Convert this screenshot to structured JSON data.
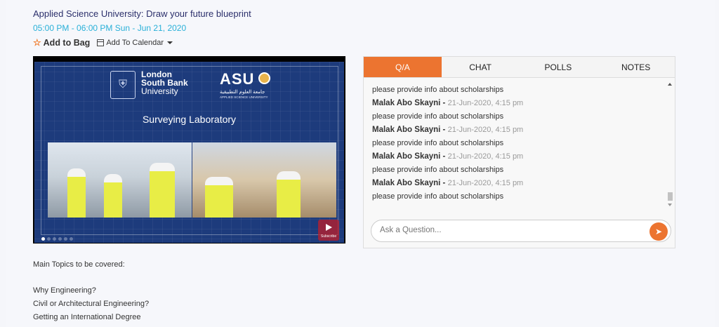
{
  "event": {
    "title": "Applied Science University: Draw your future blueprint",
    "time": "05:00 PM - 06:00 PM  Sun - Jun 21, 2020",
    "add_to_bag": "Add to Bag",
    "add_to_calendar": "Add To Calendar"
  },
  "video": {
    "lsbu_line1": "London",
    "lsbu_line2": "South Bank",
    "lsbu_line3": "University",
    "asu": "ASU",
    "asu_arabic": "جامعة العلوم التطبيقية",
    "asu_english": "APPLIED SCIENCE UNIVERSITY",
    "caption": "Surveying Laboratory",
    "subscribe": "Subscribe"
  },
  "panel": {
    "tabs": [
      "Q/A",
      "CHAT",
      "POLLS",
      "NOTES"
    ],
    "active_tab": "Q/A",
    "messages": [
      {
        "text": "please provide info about scholarships"
      },
      {
        "author": "Malak Abo Skayni",
        "time": "21-Jun-2020, 4:15 pm",
        "text": "please provide info about scholarships"
      },
      {
        "author": "Malak Abo Skayni",
        "time": "21-Jun-2020, 4:15 pm",
        "text": "please provide info about scholarships"
      },
      {
        "author": "Malak Abo Skayni",
        "time": "21-Jun-2020, 4:15 pm",
        "text": "please provide info about scholarships"
      },
      {
        "author": "Malak Abo Skayni",
        "time": "21-Jun-2020, 4:15 pm",
        "text": "please provide info about scholarships"
      }
    ],
    "ask_placeholder": "Ask a Question..."
  },
  "description": {
    "intro": "Main Topics to be covered:",
    "topics": [
      "Why Engineering?",
      "Civil or Architectural Engineering?",
      "Getting an International Degree"
    ]
  },
  "colors": {
    "accent": "#ec7430",
    "title": "#2b2f6b",
    "time": "#29b0d8"
  }
}
